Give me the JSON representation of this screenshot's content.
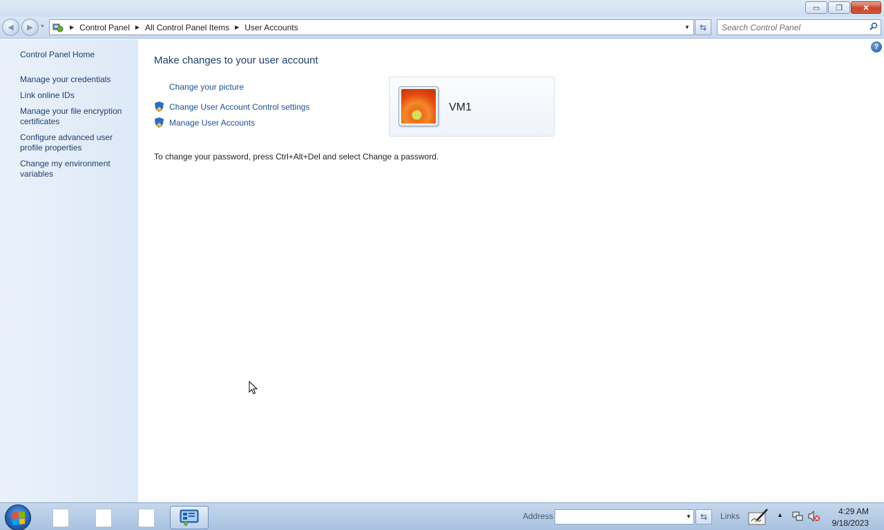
{
  "window": {
    "controls": {
      "minimize": "▭",
      "restore": "❐",
      "close": "✕"
    }
  },
  "navbar": {
    "breadcrumbs": [
      "Control Panel",
      "All Control Panel Items",
      "User Accounts"
    ],
    "search_placeholder": "Search Control Panel"
  },
  "sidebar": {
    "home": "Control Panel Home",
    "items": [
      {
        "label": "Manage your credentials"
      },
      {
        "label": "Link online IDs"
      },
      {
        "label": "Manage your file encryption certificates"
      },
      {
        "label": "Configure advanced user profile properties"
      },
      {
        "label": "Change my environment variables"
      }
    ]
  },
  "main": {
    "heading": "Make changes to your user account",
    "tasks": [
      {
        "label": "Change your picture",
        "icon": "none"
      },
      {
        "label": "Change User Account Control settings",
        "icon": "shield-icon"
      },
      {
        "label": "Manage User Accounts",
        "icon": "shield-icon"
      }
    ],
    "user": {
      "name": "VM1",
      "picture": "orange-flower"
    },
    "password_note": "To change your password, press Ctrl+Alt+Del and select Change a password."
  },
  "taskbar": {
    "address_label": "Address",
    "address_value": "",
    "links_label": "Links",
    "clock": {
      "time": "4:29 AM",
      "date": "9/18/2023"
    }
  },
  "colors": {
    "link": "#1e3f6b",
    "heading": "#1e3f6b",
    "sidebar_bg": "#e4edf9",
    "taskbar_bg": "#b7cce6"
  }
}
